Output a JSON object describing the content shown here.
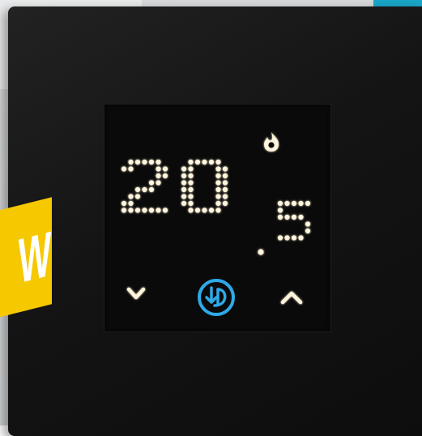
{
  "thermostat": {
    "set_temperature": "20.5",
    "digits": [
      "2",
      "0",
      "5"
    ],
    "decimal_separator": ".",
    "mode_icon": "flame-icon",
    "buttons": {
      "down": "chevron-down-icon",
      "logo": "brand-logo-icon",
      "up": "chevron-up-icon"
    },
    "colors": {
      "display": "#fff4dc",
      "logo_accent": "#2fa9e8",
      "plate": "#141414",
      "badge": "#f6c800"
    }
  },
  "badge": {
    "text": "W"
  }
}
